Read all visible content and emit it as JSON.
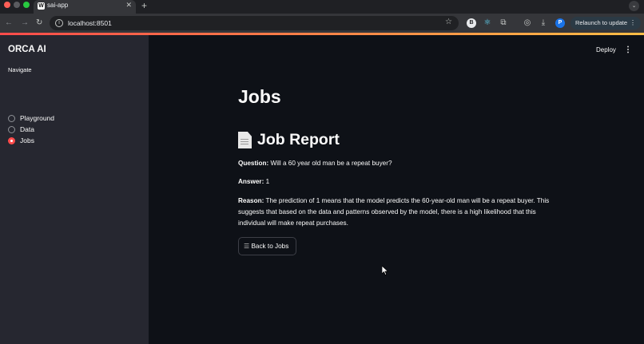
{
  "browser": {
    "tab_title": "sai-app",
    "tab_favicon": "W",
    "new_tab": "+",
    "url": "localhost:8501",
    "relaunch_label": "Relaunch to update",
    "extension_badge_1": "B",
    "extension_badge_2": "P"
  },
  "sidebar": {
    "brand": "ORCA AI",
    "nav_label": "Navigate",
    "options": [
      "Playground",
      "Data",
      "Jobs"
    ],
    "selected": "Jobs"
  },
  "header": {
    "deploy_label": "Deploy"
  },
  "main": {
    "page_title": "Jobs",
    "report_title": "Job Report",
    "question_label": "Question:",
    "question_text": " Will a 60 year old man be a repeat buyer?",
    "answer_label": "Answer:",
    "answer_text": " 1",
    "reason_label": "Reason:",
    "reason_text": " The prediction of 1 means that the model predicts the 60-year-old man will be a repeat buyer. This suggests that based on the data and patterns observed by the model, there is a high likelihood that this individual will make repeat purchases.",
    "back_button": "Back to Jobs"
  },
  "colors": {
    "accent": "#ff4b4b",
    "background": "#0e1117",
    "sidebar": "#262730"
  }
}
